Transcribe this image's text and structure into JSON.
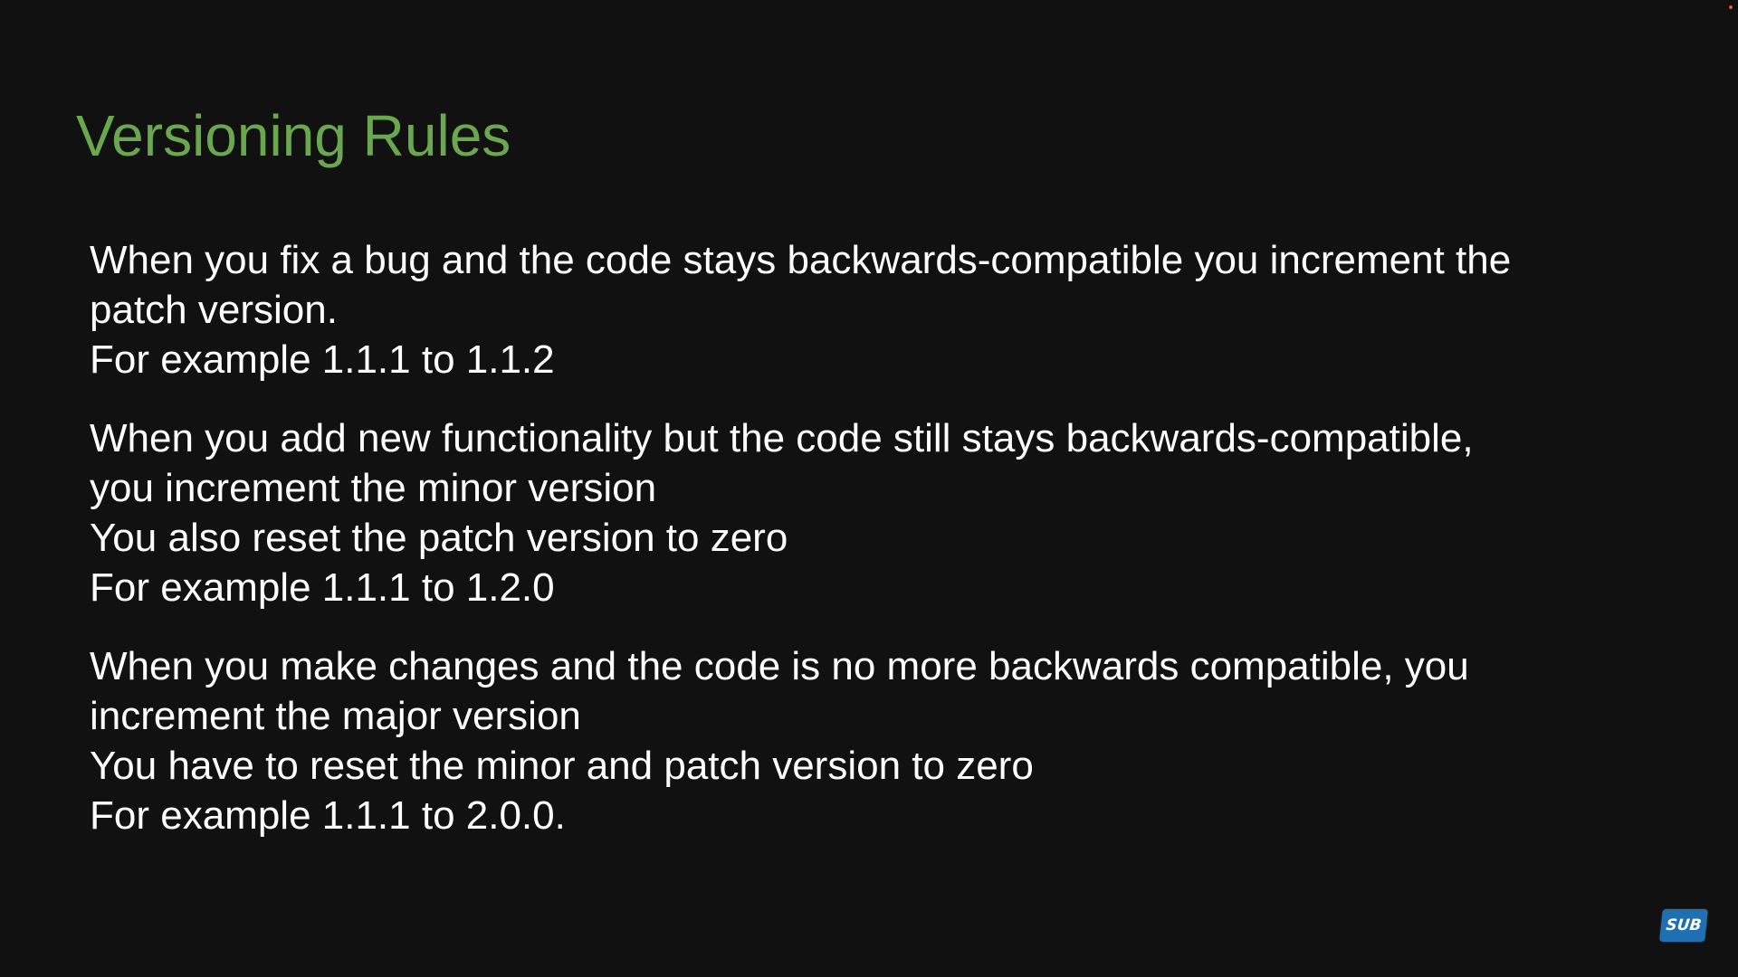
{
  "colors": {
    "background": "#111111",
    "title": "#6aa84f",
    "body_text": "#ffffff",
    "sub_badge": "#1f6fb3",
    "rec_dot": "#e0582a"
  },
  "slide": {
    "title": "Versioning Rules",
    "paragraphs": [
      {
        "lines": [
          "When you fix a bug and the code stays backwards-compatible you increment the",
          "patch version.",
          "For example 1.1.1 to 1.1.2"
        ]
      },
      {
        "lines": [
          "When you add new functionality but the code still stays backwards-compatible,",
          "you increment the minor version",
          "You also reset the patch version to zero",
          "For example 1.1.1 to 1.2.0"
        ]
      },
      {
        "lines": [
          "When you make changes and the code is no more backwards compatible, you",
          "increment the major version",
          "You have to reset the minor and patch version to zero",
          "For example 1.1.1 to 2.0.0."
        ]
      }
    ]
  },
  "overlay": {
    "sub_badge_label": "SUB",
    "sub_badge_icon": "subscribe-badge-icon"
  }
}
